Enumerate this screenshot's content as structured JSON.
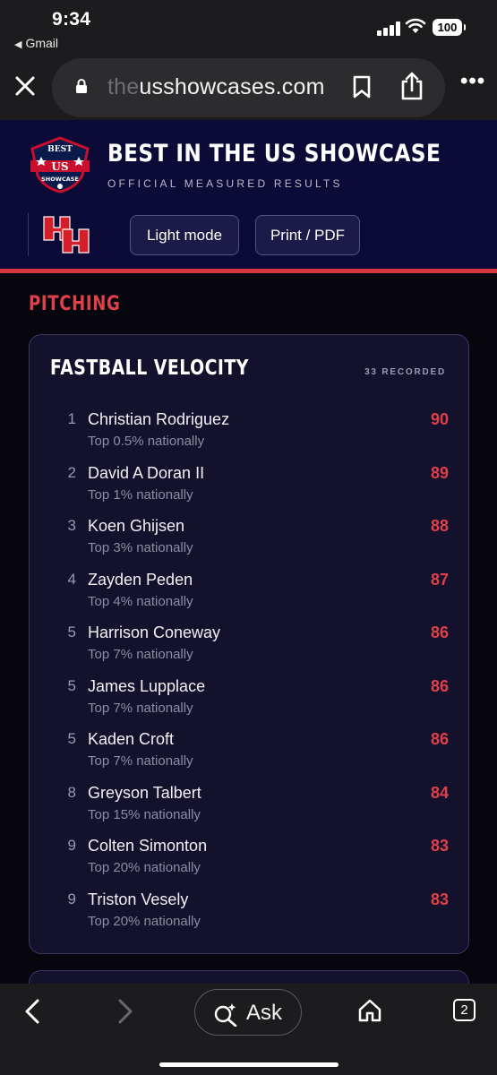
{
  "status_bar": {
    "time": "9:34",
    "back_app": "Gmail",
    "battery": "100"
  },
  "browser": {
    "url_dim": "the",
    "url_main": "usshowcases.com",
    "icons": [
      "close-icon",
      "lock-icon",
      "bookmark-icon",
      "share-icon",
      "more-icon"
    ]
  },
  "header": {
    "title": "BEST IN THE US SHOWCASE",
    "subtitle": "OFFICIAL MEASURED RESULTS",
    "logo_text": [
      "BEST",
      "US",
      "SHOWCASE"
    ],
    "team_logo_text": "UH",
    "light_mode_label": "Light mode",
    "print_label": "Print / PDF"
  },
  "section": {
    "title": "PITCHING"
  },
  "card": {
    "title": "FASTBALL VELOCITY",
    "count": "33 RECORDED",
    "rows": [
      {
        "rank": "1",
        "name": "Christian Rodriguez",
        "pct": "Top 0.5% nationally",
        "value": "90"
      },
      {
        "rank": "2",
        "name": "David A Doran II",
        "pct": "Top 1% nationally",
        "value": "89"
      },
      {
        "rank": "3",
        "name": "Koen Ghijsen",
        "pct": "Top 3% nationally",
        "value": "88"
      },
      {
        "rank": "4",
        "name": "Zayden Peden",
        "pct": "Top 4% nationally",
        "value": "87"
      },
      {
        "rank": "5",
        "name": "Harrison Coneway",
        "pct": "Top 7% nationally",
        "value": "86"
      },
      {
        "rank": "5",
        "name": "James Lupplace",
        "pct": "Top 7% nationally",
        "value": "86"
      },
      {
        "rank": "5",
        "name": "Kaden Croft",
        "pct": "Top 7% nationally",
        "value": "86"
      },
      {
        "rank": "8",
        "name": "Greyson Talbert",
        "pct": "Top 15% nationally",
        "value": "84"
      },
      {
        "rank": "9",
        "name": "Colten Simonton",
        "pct": "Top 20% nationally",
        "value": "83"
      },
      {
        "rank": "9",
        "name": "Triston Vesely",
        "pct": "Top 20% nationally",
        "value": "83"
      }
    ]
  },
  "toolbar": {
    "ask_label": "Ask",
    "tab_count": "2"
  },
  "colors": {
    "accent_red": "#e0404a",
    "header_navy": "#0c0a36",
    "card_bg": "#13112c"
  }
}
